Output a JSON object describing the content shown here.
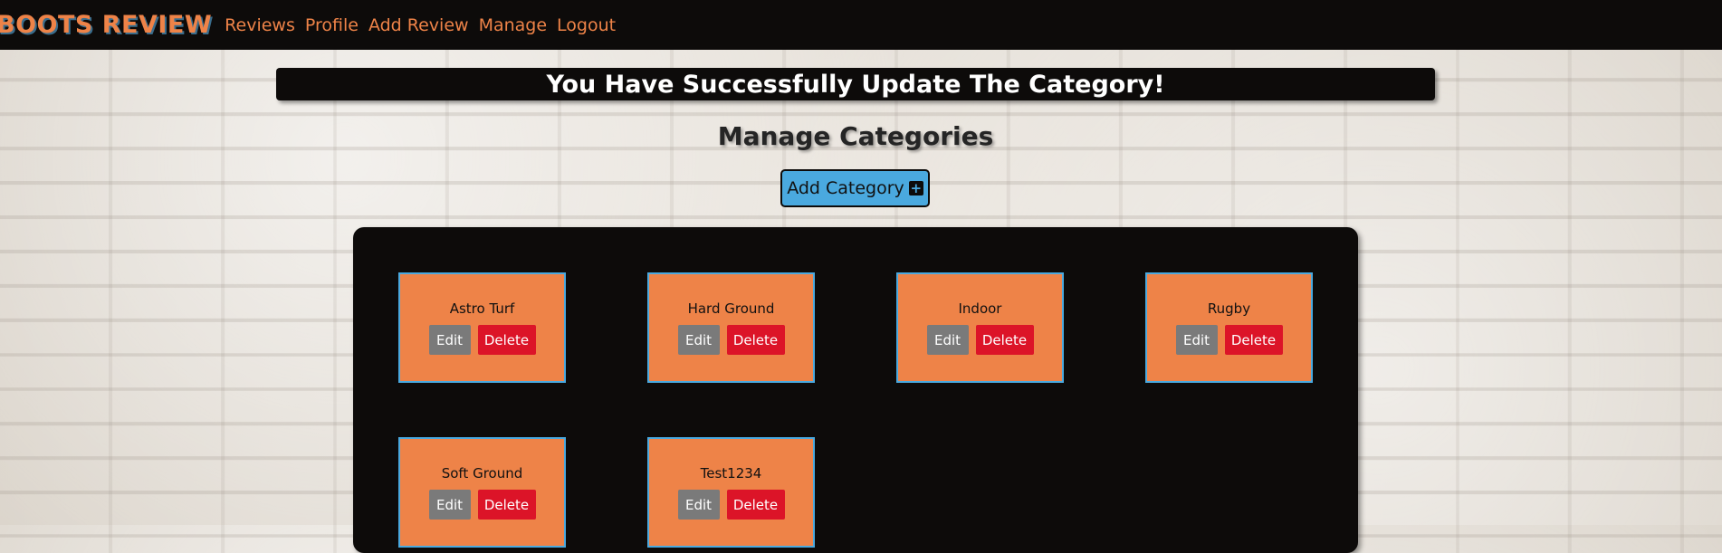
{
  "nav": {
    "brand": "BOOTS REVIEW",
    "links": [
      "Reviews",
      "Profile",
      "Add Review",
      "Manage",
      "Logout"
    ]
  },
  "flash": {
    "message": "You Have Successfully Update The Category!"
  },
  "main": {
    "title": "Manage Categories",
    "add_button_label": "Add Category",
    "add_button_icon": "plus-square-icon"
  },
  "categories": [
    {
      "name": "Astro Turf",
      "edit_label": "Edit",
      "delete_label": "Delete"
    },
    {
      "name": "Hard Ground",
      "edit_label": "Edit",
      "delete_label": "Delete"
    },
    {
      "name": "Indoor",
      "edit_label": "Edit",
      "delete_label": "Delete"
    },
    {
      "name": "Rugby",
      "edit_label": "Edit",
      "delete_label": "Delete"
    },
    {
      "name": "Soft Ground",
      "edit_label": "Edit",
      "delete_label": "Delete"
    },
    {
      "name": "Test1234",
      "edit_label": "Edit",
      "delete_label": "Delete"
    }
  ],
  "colors": {
    "brand_orange": "#ee8348",
    "accent_blue": "#4aa9df",
    "delete_red": "#dc1428",
    "edit_gray": "#7a7a7a",
    "dark": "#0d0b0a"
  }
}
